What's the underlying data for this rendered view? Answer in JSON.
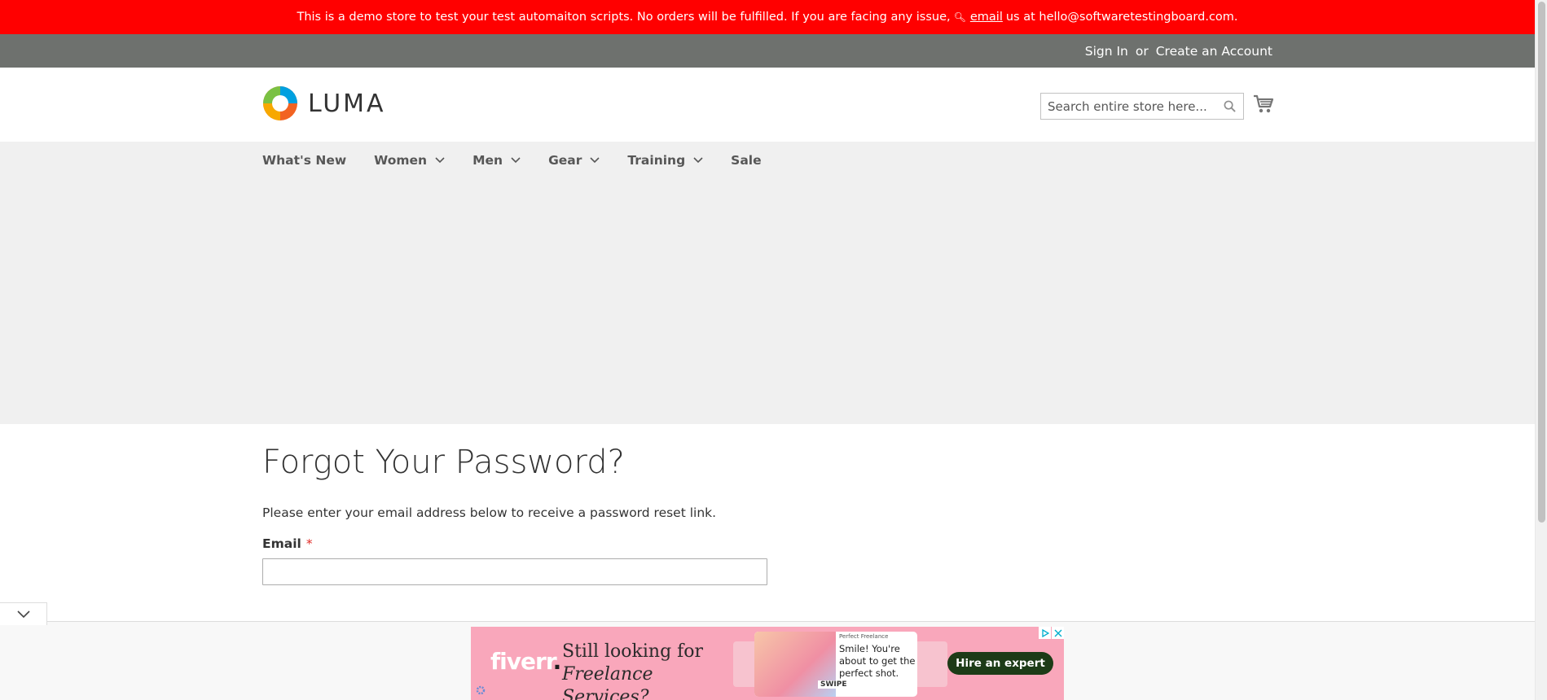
{
  "demo_notice": {
    "text_before": "This is a demo store to test your test automaiton scripts. No orders will be fulfilled. If you are facing any issue,",
    "link": "email",
    "text_after": "us at hello@softwaretestingboard.com."
  },
  "header_links": {
    "sign_in": "Sign In",
    "or": "or",
    "create_account": "Create an Account"
  },
  "logo": {
    "text": "LUMA"
  },
  "search": {
    "placeholder": "Search entire store here..."
  },
  "nav": {
    "items": [
      {
        "label": "What's New",
        "has_dropdown": false
      },
      {
        "label": "Women",
        "has_dropdown": true
      },
      {
        "label": "Men",
        "has_dropdown": true
      },
      {
        "label": "Gear",
        "has_dropdown": true
      },
      {
        "label": "Training",
        "has_dropdown": true
      },
      {
        "label": "Sale",
        "has_dropdown": false
      }
    ]
  },
  "page": {
    "title": "Forgot Your Password?",
    "intro": "Please enter your email address below to receive a password reset link.",
    "email_label": "Email",
    "required_marker": "*"
  },
  "ad": {
    "brand": "fiverr",
    "tagline_line1": "Still looking for",
    "tagline_line2": "Freelance Services?",
    "card_small": "Perfect Freelance",
    "card_text": "Smile! You're about to get the perfect shot.",
    "swipe": "SWIPE",
    "cta": "Hire an expert"
  },
  "colors": {
    "demo_bar": "#ff0000",
    "panel_header": "#6e716e",
    "nav_bg": "#f0f0f0",
    "ad_bg": "#f9a7bb",
    "ad_cta": "#1d3b17"
  }
}
